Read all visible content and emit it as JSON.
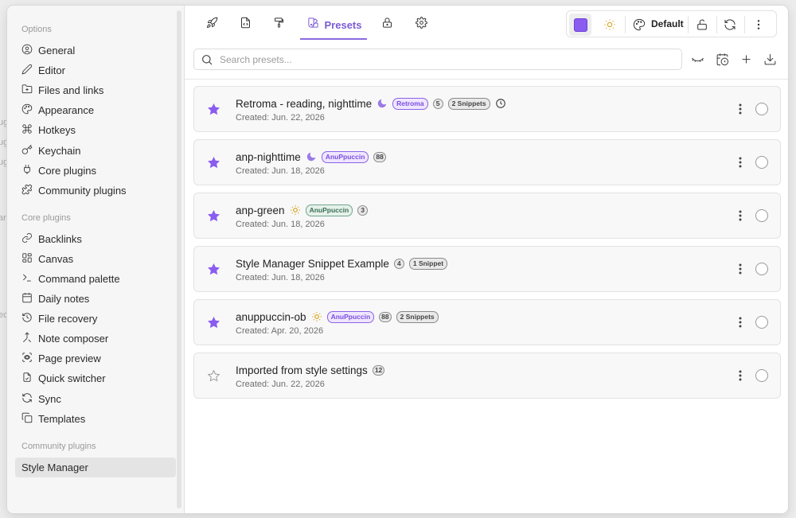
{
  "background": {
    "fragments": [
      "ug",
      "ug",
      "ug",
      "an",
      "ec"
    ]
  },
  "sidebar": {
    "options_heading": "Options",
    "options": [
      {
        "label": "General",
        "icon": "gear-circle-icon"
      },
      {
        "label": "Editor",
        "icon": "pencil-icon"
      },
      {
        "label": "Files and links",
        "icon": "folder-icon"
      },
      {
        "label": "Appearance",
        "icon": "palette-icon"
      },
      {
        "label": "Hotkeys",
        "icon": "command-icon"
      },
      {
        "label": "Keychain",
        "icon": "key-icon"
      },
      {
        "label": "Core plugins",
        "icon": "plugin-icon"
      },
      {
        "label": "Community plugins",
        "icon": "puzzle-icon"
      }
    ],
    "core_heading": "Core plugins",
    "core_plugins": [
      {
        "label": "Backlinks",
        "icon": "link-icon"
      },
      {
        "label": "Canvas",
        "icon": "canvas-icon"
      },
      {
        "label": "Command palette",
        "icon": "terminal-icon"
      },
      {
        "label": "Daily notes",
        "icon": "calendar-icon"
      },
      {
        "label": "File recovery",
        "icon": "history-icon"
      },
      {
        "label": "Note composer",
        "icon": "merge-icon"
      },
      {
        "label": "Page preview",
        "icon": "preview-icon"
      },
      {
        "label": "Quick switcher",
        "icon": "switcher-icon"
      },
      {
        "label": "Sync",
        "icon": "sync-icon"
      },
      {
        "label": "Templates",
        "icon": "templates-icon"
      }
    ],
    "community_heading": "Community plugins",
    "community_plugins": [
      {
        "label": "Style Manager",
        "active": true
      }
    ]
  },
  "tabs": {
    "active_label": "Presets"
  },
  "theme_bar": {
    "swatch_color": "#8a5cf0",
    "theme_name": "Default"
  },
  "search": {
    "placeholder": "Search presets..."
  },
  "presets": [
    {
      "name": "Retroma - reading, nighttime",
      "mode": "moon",
      "starred": true,
      "theme": "Retroma",
      "theme_color": "purple",
      "count": "5",
      "snippets": "2 Snippets",
      "scheduled": true,
      "created": "Created: Jun. 22, 2026"
    },
    {
      "name": "anp-nighttime",
      "mode": "moon",
      "starred": true,
      "theme": "AnuPpuccin",
      "theme_color": "purple",
      "count": "88",
      "snippets": "",
      "scheduled": false,
      "created": "Created: Jun. 18, 2026"
    },
    {
      "name": "anp-green",
      "mode": "sun",
      "starred": true,
      "theme": "AnuPpuccin",
      "theme_color": "green",
      "count": "3",
      "snippets": "",
      "scheduled": false,
      "created": "Created: Jun. 18, 2026"
    },
    {
      "name": "Style Manager Snippet Example",
      "mode": "",
      "starred": true,
      "theme": "",
      "theme_color": "",
      "count": "4",
      "snippets": "1 Snippet",
      "scheduled": false,
      "created": "Created: Jun. 18, 2026"
    },
    {
      "name": "anuppuccin-ob",
      "mode": "sun",
      "starred": true,
      "theme": "AnuPpuccin",
      "theme_color": "purple",
      "count": "88",
      "snippets": "2 Snippets",
      "scheduled": false,
      "created": "Created: Apr. 20, 2026"
    },
    {
      "name": "Imported from style settings",
      "mode": "",
      "starred": false,
      "theme": "",
      "theme_color": "",
      "count": "12",
      "snippets": "",
      "scheduled": false,
      "created": "Created: Jun. 22, 2026"
    }
  ],
  "colors": {
    "accent": "#7b5bd6",
    "star_filled": "#8a5cf0",
    "moon": "#9b7ae8",
    "sun": "#d4a017"
  }
}
